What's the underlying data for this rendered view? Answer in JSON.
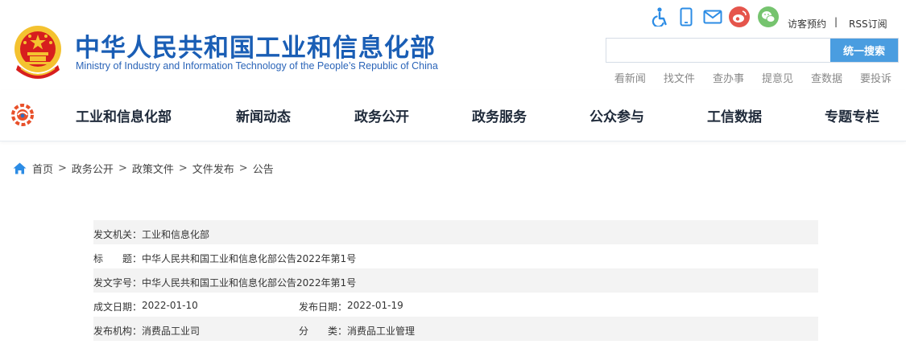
{
  "header": {
    "title": "中华人民共和国工业和信息化部",
    "subtitle": "Ministry of Industry and Information Technology of the People’s Republic of China"
  },
  "top_bar": {
    "icons": [
      "accessibility-icon",
      "mobile-icon",
      "mail-icon",
      "weibo-icon",
      "wechat-icon"
    ],
    "visitor_label": "访客预约",
    "separator": "|",
    "rss_label": "RSS订阅"
  },
  "search": {
    "placeholder": "",
    "button_label": "统一搜索"
  },
  "quick_links": [
    "看新闻",
    "找文件",
    "查办事",
    "提意见",
    "查数据",
    "要投诉"
  ],
  "nav": {
    "items": [
      "工业和信息化部",
      "新闻动态",
      "政务公开",
      "政务服务",
      "公众参与",
      "工信数据",
      "专题专栏"
    ]
  },
  "breadcrumb": {
    "items": [
      "首页",
      "政务公开",
      "政策文件",
      "文件发布",
      "公告"
    ],
    "separator": ">"
  },
  "info": {
    "issuer_label": "发文机关：",
    "issuer_value": "工业和信息化部",
    "title_label": "标　　题：",
    "title_value": "中华人民共和国工业和信息化部公告2022年第1号",
    "doc_no_label": "发文字号：",
    "doc_no_value": "中华人民共和国工业和信息化部公告2022年第1号",
    "created_label": "成文日期：",
    "created_value": "2022-01-10",
    "published_label": "发布日期：",
    "published_value": "2022-01-19",
    "org_label": "发布机构：",
    "org_value": "消费品工业司",
    "category_label": "分　　类：",
    "category_value": "消费品工业管理"
  },
  "colors": {
    "brand_blue": "#1a5eb5",
    "accent_blue": "#2c8ce5",
    "search_button": "#4a9de0",
    "weibo_red": "#e5554c",
    "wechat_green": "#76c46f",
    "emblem_red": "#d71e1e",
    "emblem_gold": "#f4c230"
  }
}
